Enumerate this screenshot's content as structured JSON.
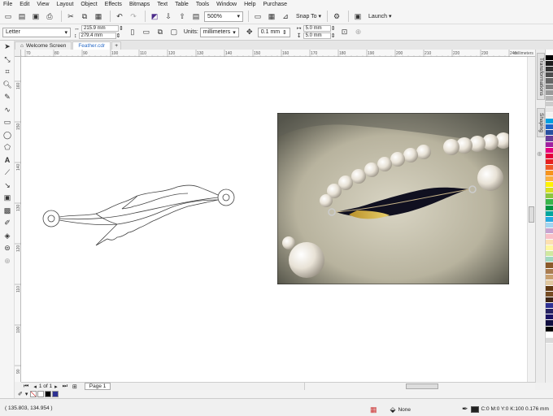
{
  "menu": [
    "File",
    "Edit",
    "View",
    "Layout",
    "Object",
    "Effects",
    "Bitmaps",
    "Text",
    "Table",
    "Tools",
    "Window",
    "Help",
    "Purchase"
  ],
  "toolbar": {
    "zoom": "500%",
    "snap_label": "Snap To",
    "launch_label": "Launch"
  },
  "property_bar": {
    "page_size": "Letter",
    "width": "215.9 mm",
    "height": "279.4 mm",
    "units_label": "Units:",
    "units": "millimeters",
    "nudge": "0.1 mm",
    "dup_x": "5.0 mm",
    "dup_y": "5.0 mm"
  },
  "tabs": [
    {
      "label": "Welcome Screen",
      "active": false
    },
    {
      "label": "Feather.cdr",
      "active": true
    }
  ],
  "hruler_labels": [
    "70",
    "80",
    "90",
    "100",
    "110",
    "120",
    "130",
    "140",
    "150",
    "160",
    "170",
    "180",
    "190",
    "200",
    "210",
    "220",
    "230",
    "240",
    "millimeters"
  ],
  "vruler_labels": [
    "160",
    "150",
    "140",
    "130",
    "120",
    "110",
    "100",
    "90",
    "80"
  ],
  "dockers": [
    "Transformations",
    "Shaping"
  ],
  "palette": [
    "#ffffff",
    "#000000",
    "#1a1a1a",
    "#333333",
    "#4d4d4d",
    "#666666",
    "#808080",
    "#999999",
    "#b3b3b3",
    "#cccccc",
    "#e6e6e6",
    "#f2f2f2",
    "#00a0e0",
    "#1e64c8",
    "#2850a0",
    "#6a3d9a",
    "#a020a0",
    "#e6007e",
    "#e4003a",
    "#e62020",
    "#f05a28",
    "#f7941d",
    "#fbb040",
    "#fff200",
    "#d7e021",
    "#8dc63f",
    "#39b54a",
    "#009444",
    "#00a79d",
    "#27aae1",
    "#a3d5f0",
    "#c7a3d0",
    "#f9c0c7",
    "#fde0b0",
    "#fff7a0",
    "#d0e8a0",
    "#a0d8c0",
    "#8b5a2b",
    "#a97c50",
    "#c8a070",
    "#e0c8a0",
    "#603913",
    "#754c24",
    "#3c2415",
    "#2e3192",
    "#262262",
    "#1b1464",
    "#0f0c3e",
    "#000000",
    "#ffffff",
    "#d9d9d9"
  ],
  "pagebar": {
    "page_count": "1 of 1",
    "page_tab": "Page 1"
  },
  "status": {
    "coords": "( 135.803, 134.954 )",
    "fill": "None",
    "outline": "C:0 M:0 Y:0 K:100  0.176 mm"
  },
  "doc_palette": [
    "#ffffff",
    "#000000",
    "#2e3192"
  ]
}
